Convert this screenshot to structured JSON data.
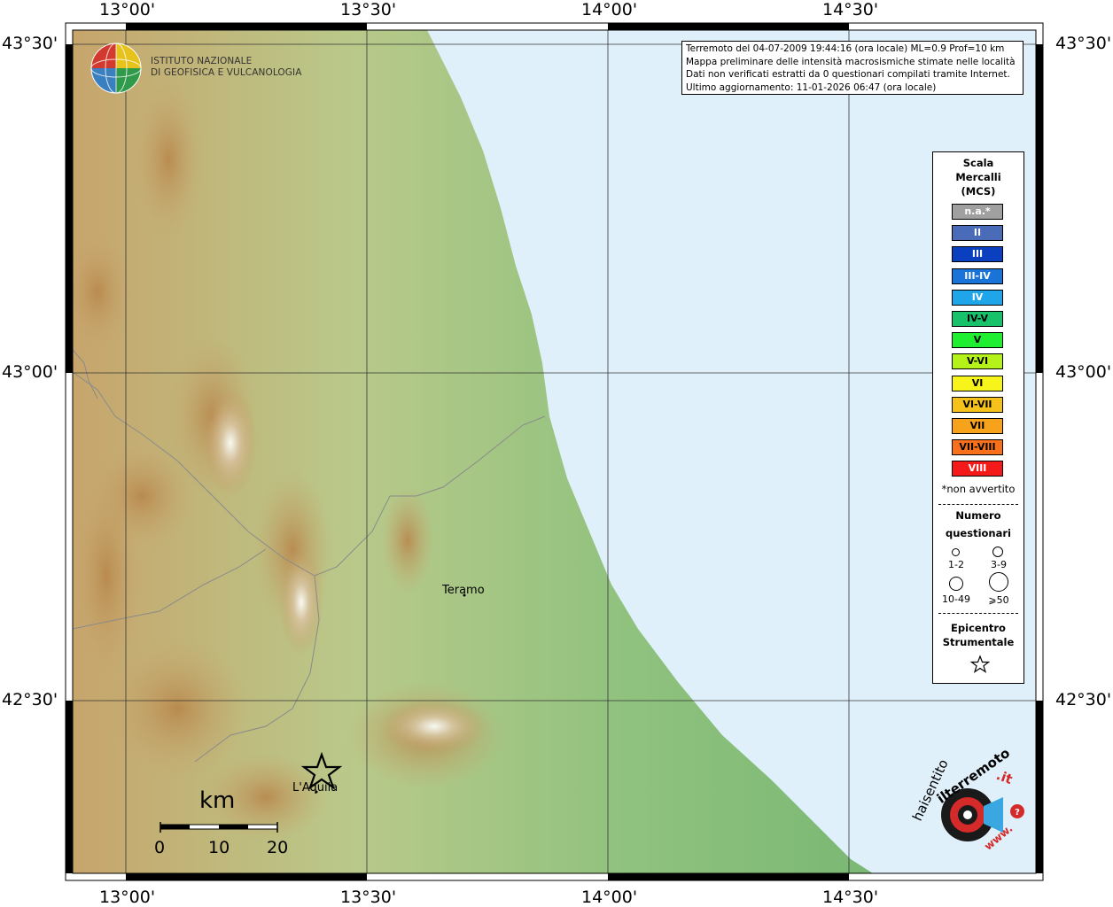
{
  "map": {
    "lon_labels": [
      "13°00'",
      "13°30'",
      "14°00'",
      "14°30'"
    ],
    "lat_labels": [
      "43°30'",
      "43°00'",
      "42°30'"
    ],
    "cities": [
      {
        "name": "Teramo"
      },
      {
        "name": "L'Aquila"
      }
    ],
    "epicenter_symbol": "star-icon",
    "colors": {
      "sea": "#dff0fb",
      "frame": "#000000"
    }
  },
  "institute": {
    "line1": "ISTITUTO NAZIONALE",
    "line2": "DI GEOFISICA E VULCANOLOGIA"
  },
  "info": {
    "line1": "Terremoto del 04-07-2009 19:44:16 (ora locale) ML=0.9 Prof=10 km",
    "line2": "Mappa preliminare delle intensità macrosismiche stimate nelle località",
    "line3": "Dati non verificati estratti da 0 questionari compilati tramite Internet.",
    "line4": "Ultimo aggiornamento: 11-01-2026 06:47 (ora locale)"
  },
  "legend": {
    "title1": "Scala",
    "title2": "Mercalli",
    "title3": "(MCS)",
    "classes": [
      {
        "label": "n.a.*",
        "color": "#a0a0a0",
        "text": "#ffffff"
      },
      {
        "label": "II",
        "color": "#4a6cb8",
        "text": "#ffffff"
      },
      {
        "label": "III",
        "color": "#0a3fbf",
        "text": "#ffffff"
      },
      {
        "label": "III-IV",
        "color": "#1a73d8",
        "text": "#ffffff"
      },
      {
        "label": "IV",
        "color": "#1fa5ea",
        "text": "#ffffff"
      },
      {
        "label": "IV-V",
        "color": "#17c26a",
        "text": "#000000"
      },
      {
        "label": "V",
        "color": "#20ee30",
        "text": "#000000"
      },
      {
        "label": "V-VI",
        "color": "#b4f21a",
        "text": "#000000"
      },
      {
        "label": "VI",
        "color": "#f6f41a",
        "text": "#000000"
      },
      {
        "label": "VI-VII",
        "color": "#f5c21c",
        "text": "#000000"
      },
      {
        "label": "VII",
        "color": "#f6a21a",
        "text": "#000000"
      },
      {
        "label": "VII-VIII",
        "color": "#f8711a",
        "text": "#000000"
      },
      {
        "label": "VIII",
        "color": "#f41a1a",
        "text": "#ffffff"
      }
    ],
    "note": "*non avvertito",
    "count_title1": "Numero",
    "count_title2": "questionari",
    "sizes": [
      "1-2",
      "3-9",
      "10-49",
      "⩾50"
    ],
    "epi_title1": "Epicentro",
    "epi_title2": "Strumentale"
  },
  "scalebar": {
    "unit": "km",
    "labels": [
      "0",
      "10",
      "20"
    ]
  },
  "site_logo": {
    "text1": "haisentito",
    "text2": "ilterremoto",
    "text3": ".it",
    "text4": "www."
  }
}
